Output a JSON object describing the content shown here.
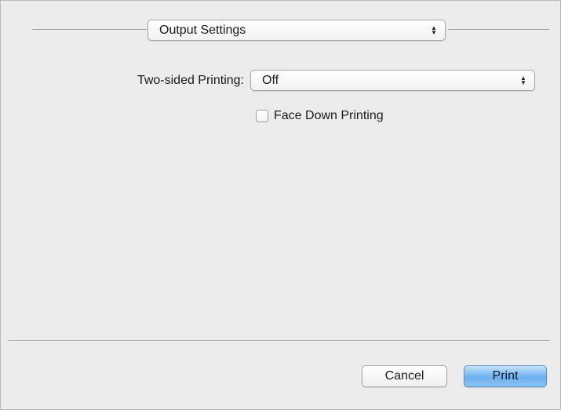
{
  "panel_selector": {
    "value": "Output Settings"
  },
  "two_sided": {
    "label": "Two-sided Printing:",
    "value": "Off"
  },
  "face_down": {
    "label": "Face Down Printing",
    "checked": false
  },
  "buttons": {
    "cancel": "Cancel",
    "print": "Print"
  },
  "icons": {
    "popup_arrows": "up-down-arrows-icon",
    "checkbox": "checkbox-unchecked"
  },
  "colors": {
    "accent": "#6bb0ef",
    "background": "#ececec"
  }
}
